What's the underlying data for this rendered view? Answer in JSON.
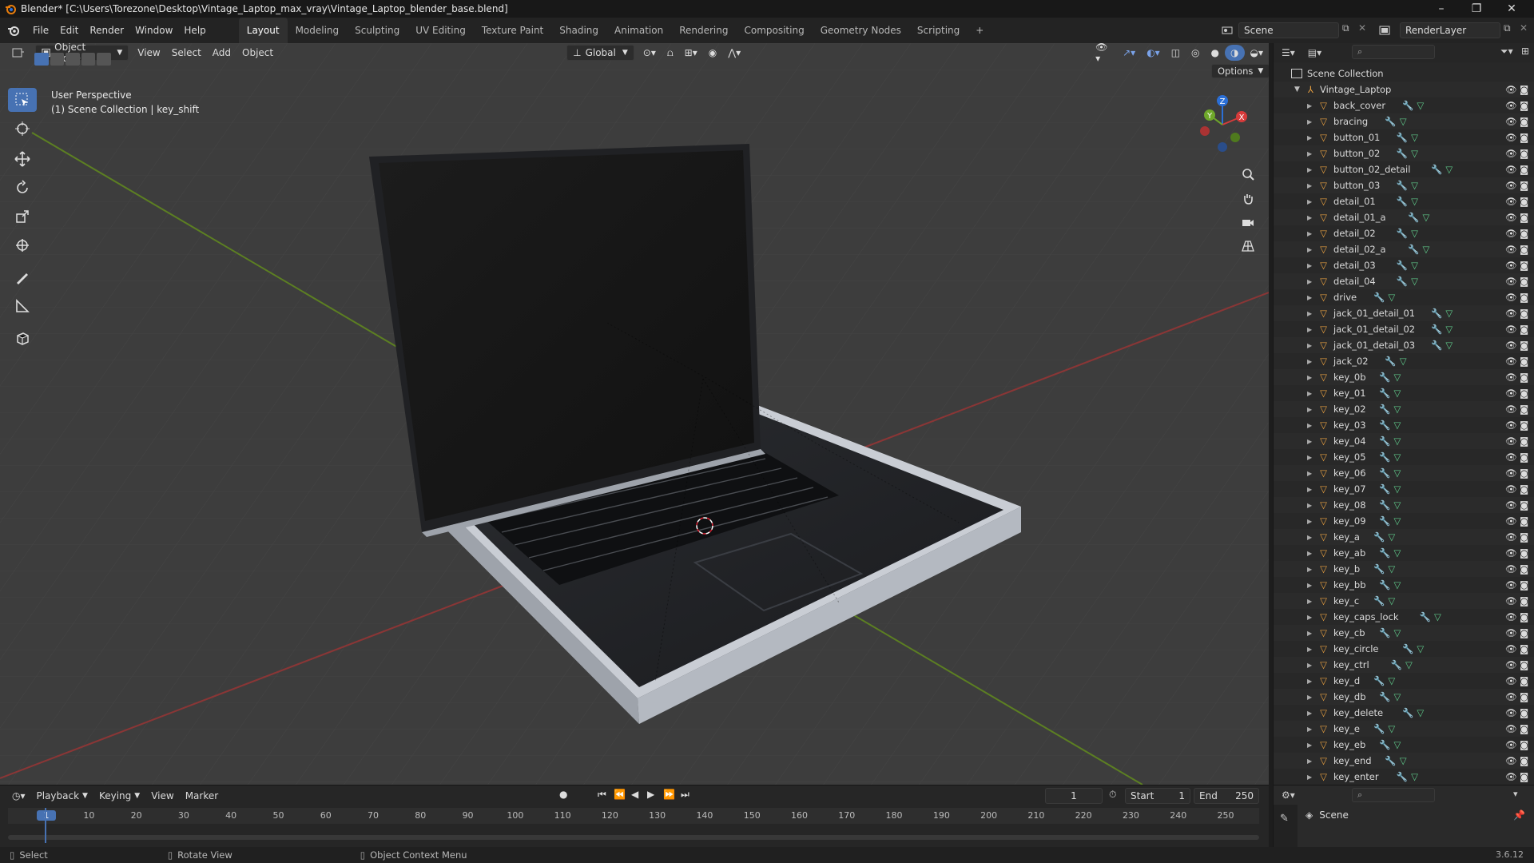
{
  "window": {
    "title": "Blender* [C:\\Users\\Torezone\\Desktop\\Vintage_Laptop_max_vray\\Vintage_Laptop_blender_base.blend]",
    "minimize": "–",
    "maximize": "❐",
    "close": "✕"
  },
  "menu": [
    "File",
    "Edit",
    "Render",
    "Window",
    "Help"
  ],
  "workspaces": [
    "Layout",
    "Modeling",
    "Sculpting",
    "UV Editing",
    "Texture Paint",
    "Shading",
    "Animation",
    "Rendering",
    "Compositing",
    "Geometry Nodes",
    "Scripting",
    "+"
  ],
  "scene_field": "Scene",
  "renderlayer_field": "RenderLayer",
  "viewport_header": {
    "mode": "Object Mode",
    "menus": [
      "View",
      "Select",
      "Add",
      "Object"
    ],
    "transform": "Global",
    "options": "Options"
  },
  "viewport_overlay": {
    "line1": "User Perspective",
    "line2": "(1) Scene Collection | key_shift"
  },
  "gizmo": {
    "x": "X",
    "y": "Y",
    "z": "Z"
  },
  "outliner": {
    "root": "Scene Collection",
    "collection": "Vintage_Laptop",
    "items": [
      "back_cover",
      "bracing",
      "button_01",
      "button_02",
      "button_02_detail",
      "button_03",
      "detail_01",
      "detail_01_a",
      "detail_02",
      "detail_02_a",
      "detail_03",
      "detail_04",
      "drive",
      "jack_01_detail_01",
      "jack_01_detail_02",
      "jack_01_detail_03",
      "jack_02",
      "key_0b",
      "key_01",
      "key_02",
      "key_03",
      "key_04",
      "key_05",
      "key_06",
      "key_07",
      "key_08",
      "key_09",
      "key_a",
      "key_ab",
      "key_b",
      "key_bb",
      "key_c",
      "key_caps_lock",
      "key_cb",
      "key_circle",
      "key_ctrl",
      "key_d",
      "key_db",
      "key_delete",
      "key_e",
      "key_eb",
      "key_end",
      "key_enter"
    ]
  },
  "properties": {
    "scene": "Scene"
  },
  "timeline": {
    "menus": [
      "Playback",
      "Keying",
      "View",
      "Marker"
    ],
    "current_frame": "1",
    "start_label": "Start",
    "start": "1",
    "end_label": "End",
    "end": "250",
    "ticks": [
      "1",
      "10",
      "20",
      "30",
      "40",
      "50",
      "60",
      "70",
      "80",
      "90",
      "100",
      "110",
      "120",
      "130",
      "140",
      "150",
      "160",
      "170",
      "180",
      "190",
      "200",
      "210",
      "220",
      "230",
      "240",
      "250"
    ]
  },
  "status": {
    "select": "Select",
    "rotate": "Rotate View",
    "context": "Object Context Menu",
    "version": "3.6.12"
  },
  "colors": {
    "accent": "#4772b3",
    "grid_x": "#9b3a3a",
    "grid_y": "#6a8f2a",
    "object_icon": "#e8a040",
    "mesh_icon": "#5fc98a",
    "modifier_icon": "#7aa2e8"
  }
}
